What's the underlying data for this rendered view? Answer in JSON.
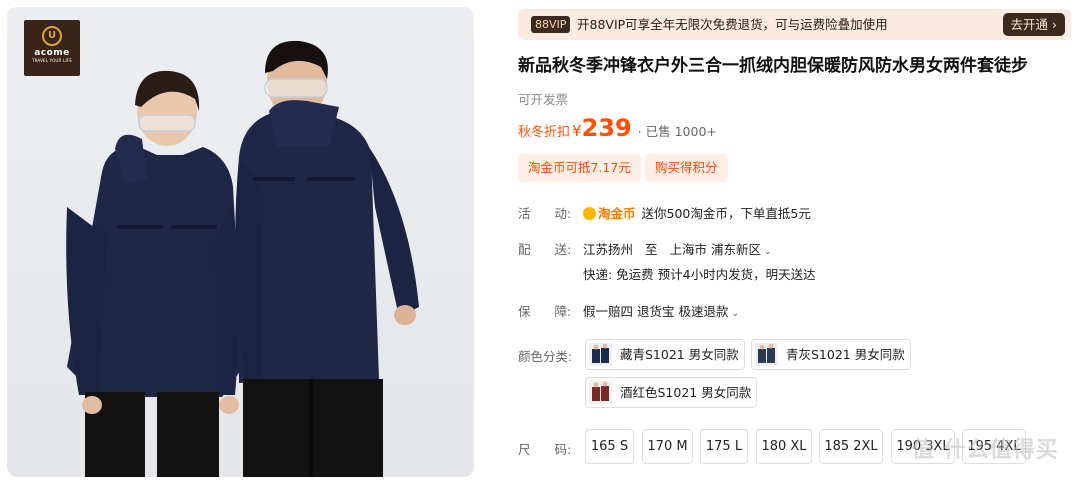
{
  "brand": {
    "name": "acome",
    "tagline": "TRAVEL YOUR LIFE",
    "mark": "U"
  },
  "vip": {
    "tag": "88VIP",
    "text": "开88VIP可享全年无限次免费退货，可与运费险叠加使用",
    "button": "去开通 ›"
  },
  "product": {
    "title": "新品秋冬季冲锋衣户外三合一抓绒内胆保暖防风防水男女两件套徒步",
    "invoice": "可开发票",
    "price_label": "秋冬折扣",
    "currency": "¥",
    "price": "239",
    "sold": "· 已售 1000+"
  },
  "coupons": [
    "淘金币可抵7.17元",
    "购买得积分"
  ],
  "activity": {
    "label_a": "活",
    "label_b": "动:",
    "coin_brand": "淘金币",
    "text": "送你500淘金币，下单直抵5元"
  },
  "delivery": {
    "label_a": "配",
    "label_b": "送:",
    "from": "江苏扬州",
    "to_word": "至",
    "to": "上海市 浦东新区",
    "line2": "快递: 免运费   预计4小时内发货，明天送达"
  },
  "guarantee": {
    "label_a": "保",
    "label_b": "障:",
    "text": "假一赔四  退货宝  极速退款"
  },
  "color_label": "颜色分类:",
  "colors": [
    {
      "label": "藏青S1021 男女同款",
      "swatch": "#1e2a4a"
    },
    {
      "label": "青灰S1021 男女同款",
      "swatch": "#2c3a55"
    },
    {
      "label": "酒红色S1021 男女同款",
      "swatch": "#7a2a23"
    }
  ],
  "size_label_a": "尺",
  "size_label_b": "码:",
  "sizes": [
    "165 S",
    "170 M",
    "175 L",
    "180 XL",
    "185 2XL",
    "190 3XL",
    "195 4XL"
  ],
  "watermark": "值 什么值得买",
  "colors_theme": {
    "accent": "#ff5000",
    "vip_dark": "#3c2a1f",
    "coupon_bg": "#ffeee5"
  }
}
